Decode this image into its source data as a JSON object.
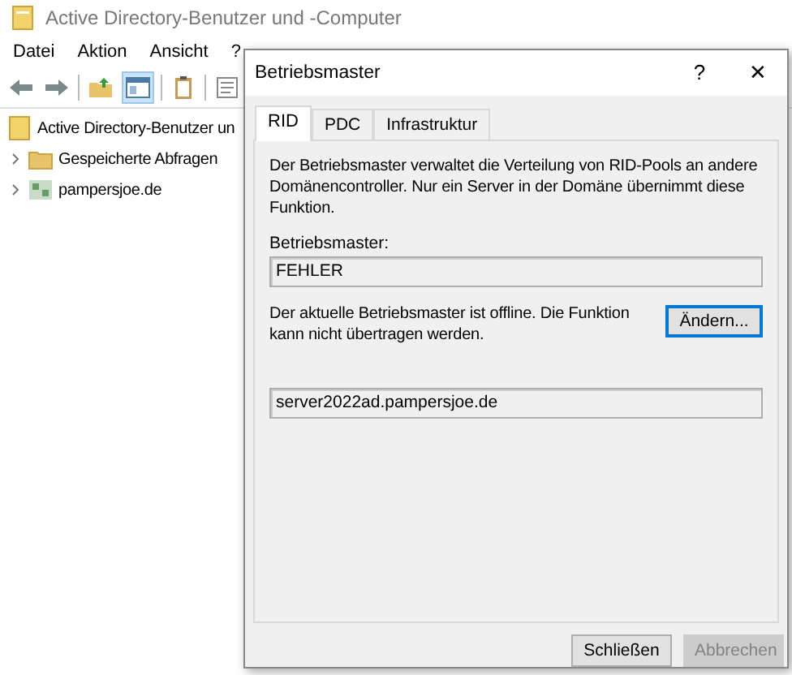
{
  "main_window": {
    "title": "Active Directory-Benutzer und -Computer"
  },
  "menu": [
    "Datei",
    "Aktion",
    "Ansicht",
    "?"
  ],
  "tree": {
    "root": "Active Directory-Benutzer un",
    "children": [
      {
        "label": "Gespeicherte Abfragen",
        "kind": "folder",
        "expanded": false
      },
      {
        "label": "pampersjoe.de",
        "kind": "domain",
        "expanded": false
      }
    ]
  },
  "dialog": {
    "title": "Betriebsmaster",
    "help": "?",
    "close": "✕",
    "tabs": [
      {
        "label": "RID",
        "selected": true
      },
      {
        "label": "PDC",
        "selected": false
      },
      {
        "label": "Infrastruktur",
        "selected": false
      }
    ],
    "description": "Der Betriebsmaster verwaltet die Verteilung von RID-Pools an andere Domänencontroller. Nur ein Server in der Domäne übernimmt diese Funktion.",
    "master_label": "Betriebsmaster:",
    "master_value": "FEHLER",
    "offline_note": "Der aktuelle Betriebsmaster ist offline. Die Funktion kann nicht übertragen werden.",
    "change_button": "Ändern...",
    "target_value": "server2022ad.pampersjoe.de",
    "buttons": [
      {
        "label": "Schließen",
        "disabled": false
      },
      {
        "label": "Abbrechen",
        "disabled": true
      }
    ]
  }
}
